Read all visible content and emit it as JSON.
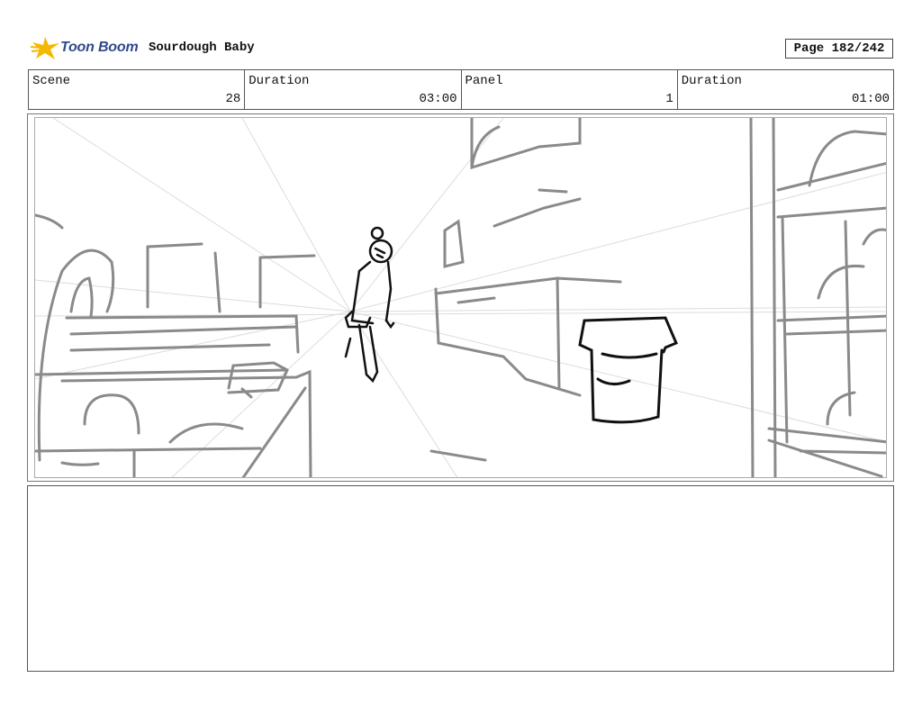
{
  "header": {
    "logo_text": "Toon Boom",
    "logo_icon": "toon-boom-star-icon",
    "project_title": "Sourdough Baby",
    "page": "Page 182/242"
  },
  "info": {
    "scene_label": "Scene",
    "scene_value": "28",
    "scene_duration_label": "Duration",
    "scene_duration_value": "03:00",
    "panel_label": "Panel",
    "panel_value": "1",
    "panel_duration_label": "Duration",
    "panel_duration_value": "01:00"
  },
  "panel": {
    "sketch": "store-aisle-sketch"
  },
  "notes": {
    "text": ""
  }
}
